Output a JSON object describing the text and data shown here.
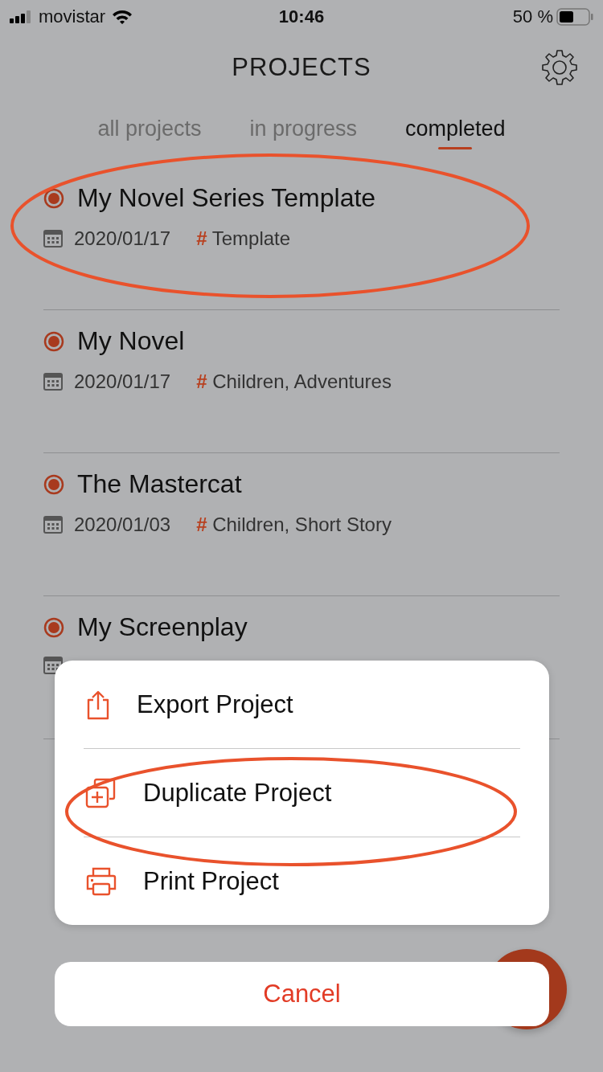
{
  "status_bar": {
    "carrier": "movistar",
    "time": "10:46",
    "battery": "50 %"
  },
  "header": {
    "title": "PROJECTS"
  },
  "tabs": [
    {
      "label": "all projects",
      "selected": false
    },
    {
      "label": "in progress",
      "selected": false
    },
    {
      "label": "completed",
      "selected": true
    }
  ],
  "projects": [
    {
      "title": "My Novel Series Template",
      "date": "2020/01/17",
      "tag_mark": "#",
      "tags": "Template",
      "highlighted": true
    },
    {
      "title": "My Novel",
      "date": "2020/01/17",
      "tag_mark": "#",
      "tags": "Children, Adventures",
      "highlighted": false
    },
    {
      "title": "The Mastercat",
      "date": "2020/01/03",
      "tag_mark": "#",
      "tags": "Children, Short Story",
      "highlighted": false
    },
    {
      "title": "My Screenplay",
      "highlighted": false
    }
  ],
  "action_sheet": {
    "items": [
      {
        "kind": "export",
        "label": "Export Project",
        "highlighted": false
      },
      {
        "kind": "duplicate",
        "label": "Duplicate Project",
        "highlighted": true
      },
      {
        "kind": "print",
        "label": "Print Project",
        "highlighted": false
      }
    ],
    "cancel": "Cancel"
  }
}
